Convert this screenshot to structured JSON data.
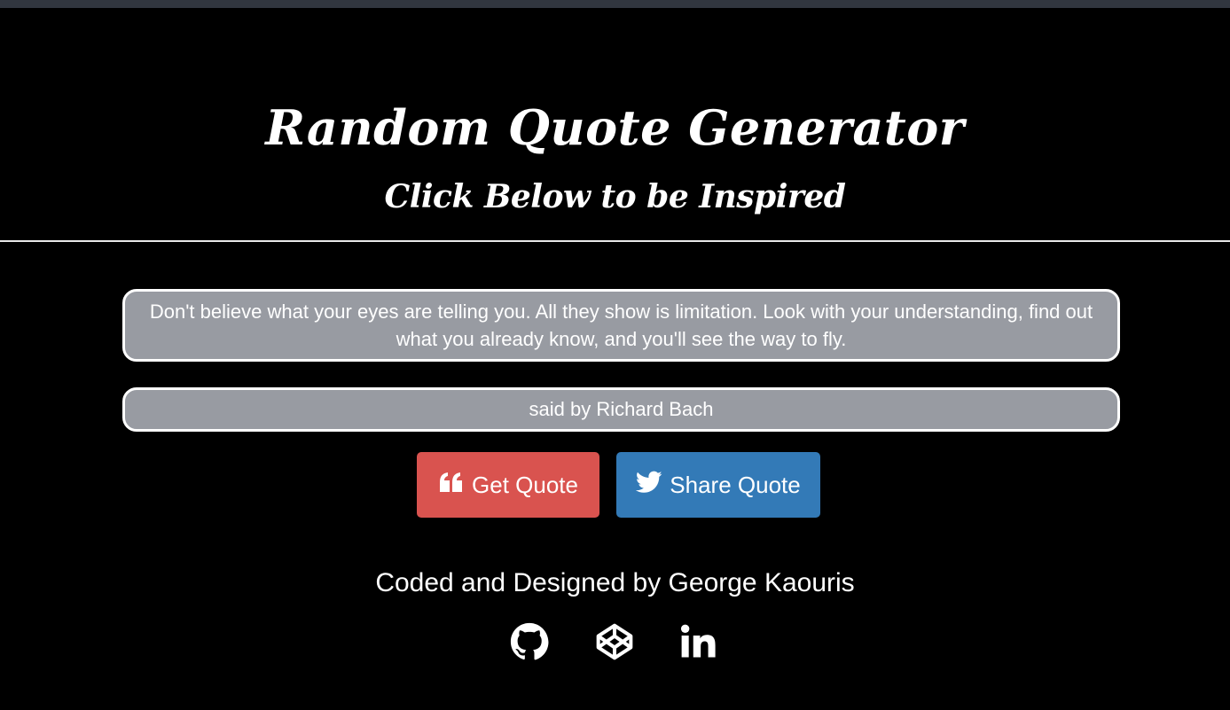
{
  "header": {
    "title": "Random Quote Generator",
    "subtitle": "Click Below to be Inspired"
  },
  "quote": {
    "text": "Don't believe what your eyes are telling you. All they show is limitation. Look with your understanding, find out what you already know, and you'll see the way to fly.",
    "author_line": "said by Richard Bach"
  },
  "buttons": {
    "get_quote": {
      "label": "Get Quote",
      "icon": "quote-left-icon",
      "color": "#d9534f"
    },
    "share_quote": {
      "label": "Share Quote",
      "icon": "twitter-icon",
      "color": "#337ab7"
    }
  },
  "footer": {
    "credit": "Coded and Designed by George Kaouris",
    "social": [
      {
        "icon": "github-icon"
      },
      {
        "icon": "codepen-icon"
      },
      {
        "icon": "linkedin-icon"
      }
    ]
  },
  "colors": {
    "background": "#000000",
    "top_bar": "#31363f",
    "box_fill": "#989ba2",
    "text": "#ffffff"
  }
}
